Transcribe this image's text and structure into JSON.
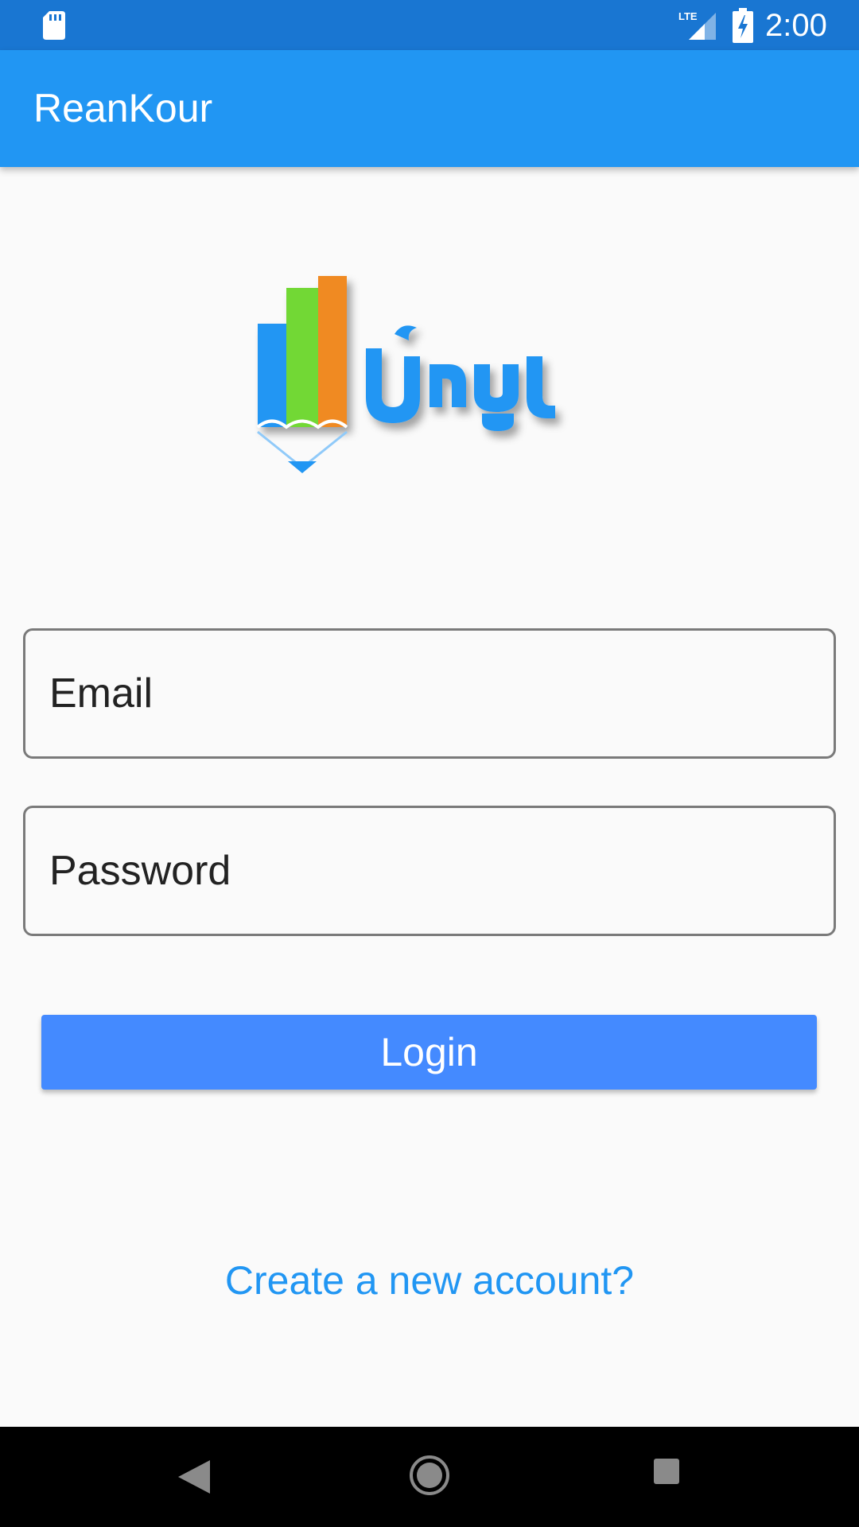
{
  "status_bar": {
    "time": "2:00",
    "network": "LTE",
    "icons": [
      "sd-card-icon",
      "lte-signal-icon",
      "battery-charging-icon"
    ]
  },
  "app_bar": {
    "title": "ReanKour"
  },
  "logo": {
    "alt": "ReanKour logo",
    "colors": {
      "blue": "#2196f3",
      "green": "#72d835",
      "orange": "#f08a24"
    }
  },
  "form": {
    "email": {
      "placeholder": "Email",
      "value": ""
    },
    "password": {
      "placeholder": "Password",
      "value": ""
    },
    "login_label": "Login",
    "create_account_label": "Create a new account?"
  },
  "nav_bar": {
    "icons": [
      "back-icon",
      "home-icon",
      "recents-icon"
    ]
  },
  "theme": {
    "primary": "#2196f3",
    "primary_dark": "#1976d2",
    "button": "#448aff",
    "background": "#fafafa"
  }
}
